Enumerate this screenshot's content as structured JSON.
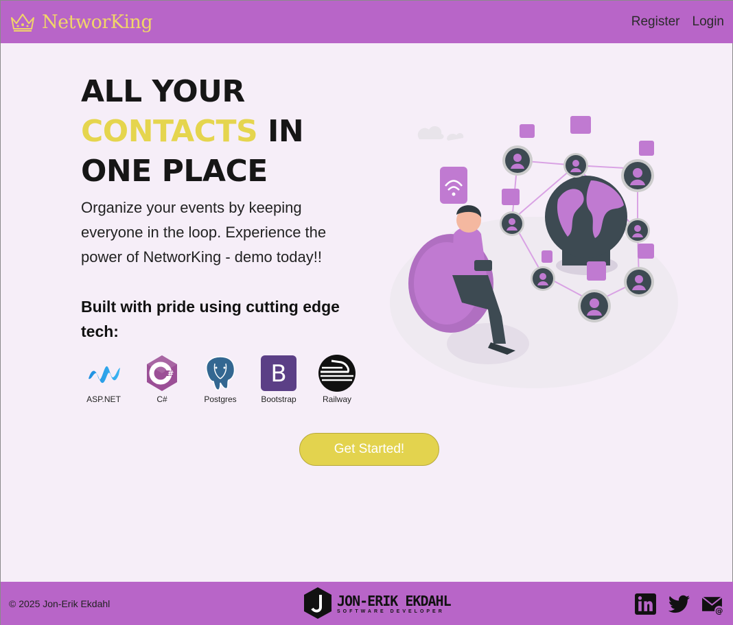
{
  "nav": {
    "brand": "NetworKing",
    "links": [
      {
        "label": "Register"
      },
      {
        "label": "Login"
      }
    ]
  },
  "hero": {
    "title_line1": "ALL YOUR",
    "title_accent": "CONTACTS",
    "title_rest": " IN ONE PLACE",
    "description": "Organize your events by keeping everyone in the loop. Experience the power of NetworKing - demo today!!",
    "tech_heading": "Built with pride using cutting edge tech:",
    "tech": [
      {
        "label": "ASP.NET",
        "icon": "aspnet-icon"
      },
      {
        "label": "C#",
        "icon": "csharp-icon"
      },
      {
        "label": "Postgres",
        "icon": "postgres-icon"
      },
      {
        "label": "Bootstrap",
        "icon": "bootstrap-icon"
      },
      {
        "label": "Railway",
        "icon": "railway-icon"
      }
    ],
    "cta_label": "Get Started!"
  },
  "footer": {
    "copyright": "© 2025 Jon-Erik Ekdahl",
    "logo_name": "JON-ERIK EKDAHL",
    "logo_subtitle": "SOFTWARE DEVELOPER",
    "socials": [
      "linkedin-icon",
      "twitter-icon",
      "email-icon"
    ]
  },
  "colors": {
    "navbar": "#b865c8",
    "background": "#f6eef8",
    "accent": "#e3d34e",
    "illustration_purple": "#c07ad1"
  }
}
